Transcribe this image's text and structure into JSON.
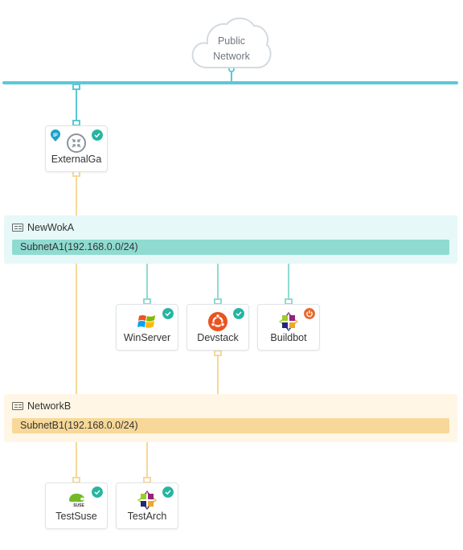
{
  "colors": {
    "public_line": "#5bc8d8",
    "net_a_line": "#8fdbd1",
    "net_b_line": "#f7d898",
    "ok_badge": "#26b5a0",
    "off_badge": "#e8692c"
  },
  "public_network": {
    "label_line1": "Public",
    "label_line2": "Network"
  },
  "router": {
    "name": "ExternalGa",
    "status": "active",
    "ip_badge": "IP",
    "icon": "router-icon"
  },
  "networks": [
    {
      "name": "NewWokA",
      "subnet": "SubnetA1(192.168.0.0/24)",
      "icon": "network-icon"
    },
    {
      "name": "NetworkB",
      "subnet": "SubnetB1(192.168.0.0/24)",
      "icon": "network-icon"
    }
  ],
  "instances": [
    {
      "name": "WinServer",
      "os_icon": "windows-icon",
      "status": "active"
    },
    {
      "name": "Devstack",
      "os_icon": "ubuntu-icon",
      "status": "active"
    },
    {
      "name": "Buildbot",
      "os_icon": "centos-icon",
      "status": "shutoff"
    },
    {
      "name": "TestSuse",
      "os_icon": "opensuse-icon",
      "status": "active"
    },
    {
      "name": "TestArch",
      "os_icon": "centos-icon",
      "status": "active"
    }
  ]
}
